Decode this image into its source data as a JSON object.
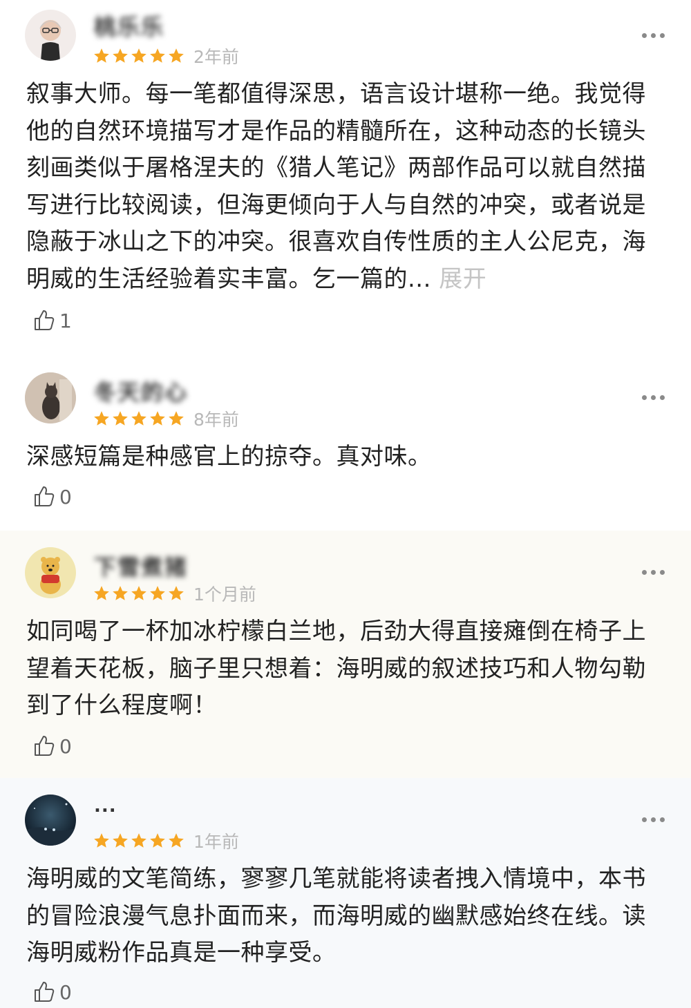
{
  "reviews": [
    {
      "username": "桃乐乐",
      "avatar": "elderly-woman-avatar",
      "rating": 5,
      "time": "2年前",
      "content": "叙事大师。每一笔都值得深思，语言设计堪称一绝。我觉得他的自然环境描写才是作品的精髓所在，这种动态的长镜头刻画类似于屠格涅夫的《猎人笔记》两部作品可以就自然描写进行比较阅读，但海更倾向于人与自然的冲突，或者说是隐蔽于冰山之下的冲突。很喜欢自传性质的主人公尼克，海明威的生活经验着实丰富。乞一篇的...",
      "expand_label": "展开",
      "likes": "1"
    },
    {
      "username": "冬天的心",
      "avatar": "cat-avatar",
      "rating": 5,
      "time": "8年前",
      "content": "深感短篇是种感官上的掠夺。真对味。",
      "likes": "0"
    },
    {
      "username": "下雪煮猪",
      "avatar": "winnie-the-pooh-avatar",
      "rating": 5,
      "time": "1个月前",
      "content": "如同喝了一杯加冰柠檬白兰地，后劲大得直接瘫倒在椅子上望着天花板，脑子里只想着：海明威的叙述技巧和人物勾勒到了什么程度啊！",
      "likes": "0"
    },
    {
      "username": "...",
      "avatar": "night-scene-avatar",
      "rating": 5,
      "time": "1年前",
      "content": "海明威的文笔简练，寥寥几笔就能将读者拽入情境中，本书的冒险浪漫气息扑面而来，而海明威的幽默感始终在线。读海明威粉作品真是一种享受。",
      "likes": "0"
    }
  ],
  "colors": {
    "star": "#f6a623",
    "muted": "#b8b8b8",
    "text": "#222222"
  }
}
